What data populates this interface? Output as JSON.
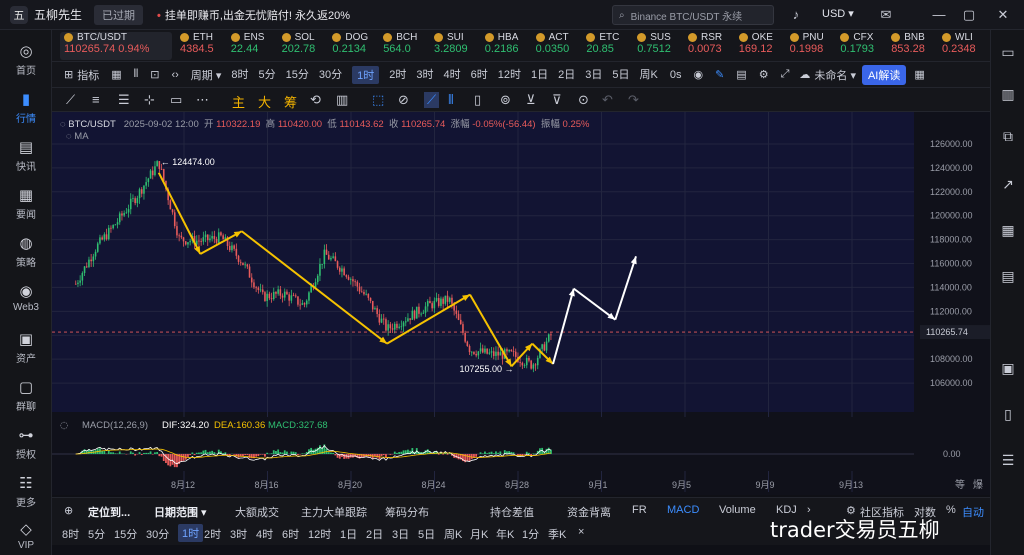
{
  "titlebar": {
    "logo": "五",
    "app_name": "五柳先生",
    "expired_label": "已过期",
    "promo_prefix": "•",
    "promo_text": "挂单即赚币,出金无忧赔付!  永久返20%",
    "search_placeholder": "Binance BTC/USDT 永续",
    "currency": "USD ▾"
  },
  "sidebar": {
    "items": [
      {
        "label": "首页",
        "icon": "home-icon",
        "glyph": "◎"
      },
      {
        "label": "行情",
        "icon": "chart-bars-icon",
        "glyph": "▮"
      },
      {
        "label": "快讯",
        "icon": "flash-news-icon",
        "glyph": "▤"
      },
      {
        "label": "要闻",
        "icon": "news-icon",
        "glyph": "▦"
      },
      {
        "label": "策略",
        "icon": "strategy-icon",
        "glyph": "◍"
      },
      {
        "label": "Web3",
        "icon": "web3-icon",
        "glyph": "◉"
      },
      {
        "label": "资产",
        "icon": "assets-icon",
        "glyph": "▣"
      },
      {
        "label": "群聊",
        "icon": "chat-icon",
        "glyph": "▢"
      },
      {
        "label": "授权",
        "icon": "key-icon",
        "glyph": "⊶"
      },
      {
        "label": "更多",
        "icon": "more-icon",
        "glyph": "☷"
      },
      {
        "label": "VIP",
        "icon": "vip-diamond-icon",
        "glyph": "◇"
      }
    ]
  },
  "tickers": [
    {
      "sym": "BTC/USDT",
      "price": "110265.74",
      "chg": "0.94%",
      "color": "#e85b5b"
    },
    {
      "sym": "ETH",
      "price": "4384.5",
      "color": "#e85b5b"
    },
    {
      "sym": "ENS",
      "price": "22.44",
      "color": "#2fbf71"
    },
    {
      "sym": "SOL",
      "price": "202.78",
      "color": "#2fbf71"
    },
    {
      "sym": "DOG",
      "price": "0.2134",
      "color": "#2fbf71"
    },
    {
      "sym": "BCH",
      "price": "564.0",
      "color": "#2fbf71"
    },
    {
      "sym": "SUI",
      "price": "3.2809",
      "color": "#2fbf71"
    },
    {
      "sym": "HBA",
      "price": "0.2186",
      "color": "#2fbf71"
    },
    {
      "sym": "ACT",
      "price": "0.0350",
      "color": "#2fbf71"
    },
    {
      "sym": "ETC",
      "price": "20.85",
      "color": "#2fbf71"
    },
    {
      "sym": "SUS",
      "price": "0.7512",
      "color": "#2fbf71"
    },
    {
      "sym": "RSR",
      "price": "0.0073",
      "color": "#e85b5b"
    },
    {
      "sym": "OKE",
      "price": "169.12",
      "color": "#e85b5b"
    },
    {
      "sym": "PNU",
      "price": "0.1998",
      "color": "#e85b5b"
    },
    {
      "sym": "CFX",
      "price": "0.1793",
      "color": "#2fbf71"
    },
    {
      "sym": "BNB",
      "price": "853.28",
      "color": "#e85b5b"
    },
    {
      "sym": "WLI",
      "price": "0.2348",
      "color": "#e85b5b"
    }
  ],
  "toolbar": {
    "indicators": "指标",
    "periods_label": "周期 ▾",
    "periods": [
      "8时",
      "5分",
      "15分",
      "30分",
      "1时",
      "2时",
      "3时",
      "4时",
      "6时",
      "12时",
      "1日",
      "2日",
      "3日",
      "5日",
      "周K"
    ],
    "active_period": "1时",
    "countdown": "0s",
    "named_layout": "未命名 ▾",
    "ai_button": "AI解读"
  },
  "drawing_tools": {
    "labels": [
      "主",
      "大",
      "筹"
    ]
  },
  "chart_info": {
    "pair": "BTC/USDT",
    "datetime": "2025-09-02 12:00",
    "open_label": "开",
    "open": "110322.19",
    "high_label": "高",
    "high": "110420.00",
    "low_label": "低",
    "low": "110143.62",
    "close_label": "收",
    "close": "110265.74",
    "change_label": "涨幅",
    "change": "-0.05%(-56.44)",
    "amplitude_label": "振幅",
    "amplitude": "0.25%",
    "ma_label": "MA"
  },
  "macd_info": {
    "label": "MACD(12,26,9)",
    "dif": "DIF:324.20",
    "dea": "DEA:160.36",
    "macd": "MACD:327.68"
  },
  "chart_data": {
    "type": "candlestick",
    "y_ticks": [
      "126000.00",
      "124000.00",
      "122000.00",
      "120000.00",
      "118000.00",
      "116000.00",
      "114000.00",
      "112000.00",
      "110000.00",
      "108000.00",
      "106000.00"
    ],
    "ylim": [
      104000,
      127000
    ],
    "x_ticks": [
      "8月12",
      "8月16",
      "8月20",
      "8月24",
      "8月28",
      "9月1",
      "9月5",
      "9月9",
      "9月13"
    ],
    "current_price": 110265.74,
    "annotations": [
      {
        "text": "← 124474.00",
        "price": 124474
      },
      {
        "text": "107255.00 →",
        "price": 107255
      }
    ],
    "path": [
      {
        "date": "2025-08-10",
        "price": 114300
      },
      {
        "date": "2025-08-11",
        "price": 117400
      },
      {
        "date": "2025-08-12",
        "price": 119500
      },
      {
        "date": "2025-08-13",
        "price": 121800
      },
      {
        "date": "2025-08-14",
        "price": 124474
      },
      {
        "date": "2025-08-15",
        "price": 118000
      },
      {
        "date": "2025-08-16",
        "price": 117900
      },
      {
        "date": "2025-08-17",
        "price": 118200
      },
      {
        "date": "2025-08-18",
        "price": 116200
      },
      {
        "date": "2025-08-19",
        "price": 113200
      },
      {
        "date": "2025-08-20",
        "price": 113500
      },
      {
        "date": "2025-08-21",
        "price": 112500
      },
      {
        "date": "2025-08-22",
        "price": 116800
      },
      {
        "date": "2025-08-23",
        "price": 115300
      },
      {
        "date": "2025-08-24",
        "price": 113200
      },
      {
        "date": "2025-08-25",
        "price": 110500
      },
      {
        "date": "2025-08-26",
        "price": 111500
      },
      {
        "date": "2025-08-27",
        "price": 112500
      },
      {
        "date": "2025-08-28",
        "price": 113000
      },
      {
        "date": "2025-08-29",
        "price": 108800
      },
      {
        "date": "2025-08-30",
        "price": 108400
      },
      {
        "date": "2025-08-31",
        "price": 108400
      },
      {
        "date": "2025-09-01",
        "price": 107500
      },
      {
        "date": "2025-09-02",
        "price": 110265
      }
    ],
    "yellow_lines": [
      [
        {
          "date": "2025-08-14",
          "price": 123600
        },
        {
          "date": "2025-08-16",
          "price": 116800
        },
        {
          "date": "2025-08-18",
          "price": 118700
        }
      ],
      [
        {
          "date": "2025-08-18",
          "price": 118700
        },
        {
          "date": "2025-08-25",
          "price": 109300
        },
        {
          "date": "2025-08-29",
          "price": 113400
        },
        {
          "date": "2025-08-31",
          "price": 107400
        },
        {
          "date": "2025-09-01",
          "price": 109300
        },
        {
          "date": "2025-09-02",
          "price": 107600
        }
      ]
    ],
    "white_forecast": [
      {
        "date": "2025-09-02",
        "price": 107600
      },
      {
        "date": "2025-09-03",
        "price": 113900
      },
      {
        "date": "2025-09-05",
        "price": 111300
      },
      {
        "date": "2025-09-06",
        "price": 116600
      }
    ]
  },
  "bottom_tabs": {
    "items": [
      "定位到...",
      "日期范围 ▾",
      "大额成交",
      "主力大单跟踪",
      "筹码分布",
      "持仓差值",
      "资金背离",
      "FR",
      "MACD",
      "Volume",
      "KDJ",
      "社区指标",
      "对数",
      "%",
      "自动"
    ],
    "active": "MACD"
  },
  "bottom_periods": {
    "items": [
      "8时",
      "5分",
      "15分",
      "30分",
      "1时",
      "2时",
      "3时",
      "4时",
      "6时",
      "12时",
      "1日",
      "2日",
      "3日",
      "5日",
      "周K",
      "月K",
      "年K",
      "1分",
      "季K"
    ],
    "active": "1时",
    "close": "×"
  },
  "right_axis_footer": {
    "a": "等",
    "b": "爆"
  },
  "watermark": "trader交易员五柳"
}
